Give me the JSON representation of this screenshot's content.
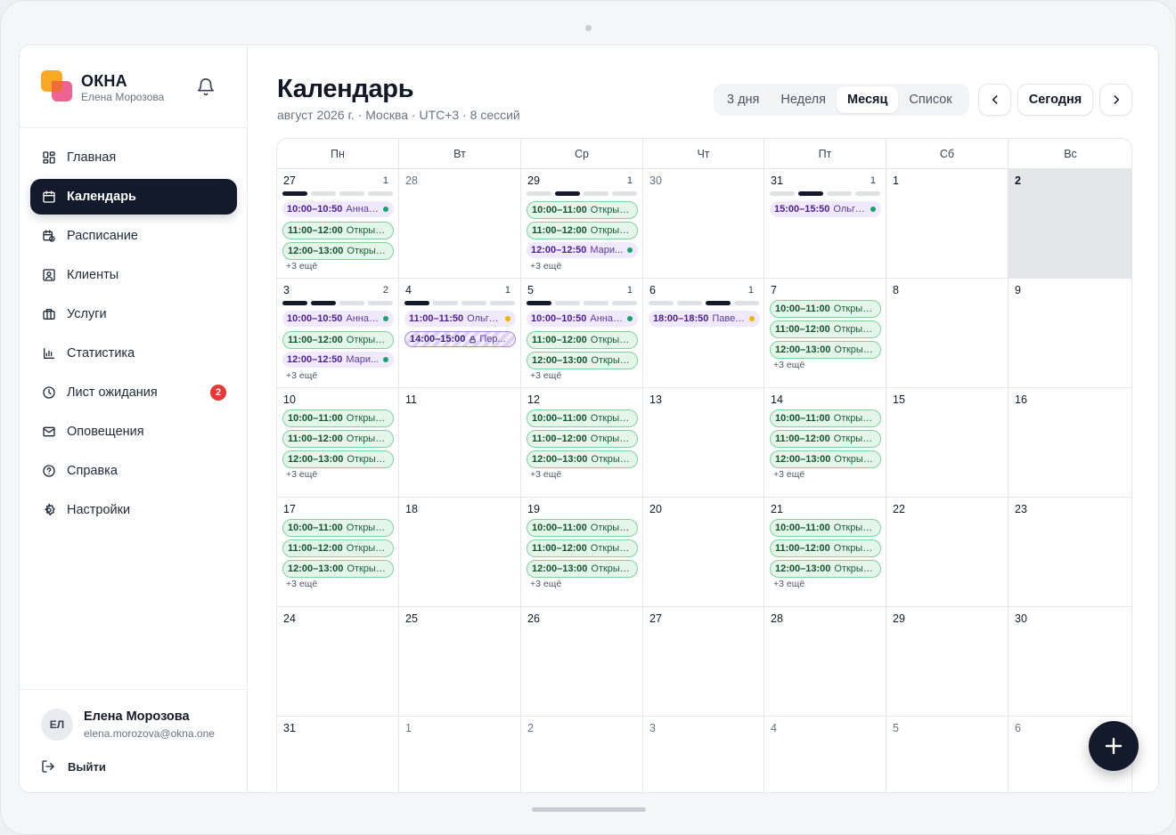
{
  "brand": {
    "name": "ОКНА",
    "user": "Елена Морозова"
  },
  "nav": [
    {
      "label": "Главная",
      "icon": "dashboard-icon",
      "active": false
    },
    {
      "label": "Календарь",
      "icon": "calendar-icon",
      "active": true
    },
    {
      "label": "Расписание",
      "icon": "schedule-icon",
      "active": false
    },
    {
      "label": "Клиенты",
      "icon": "clients-icon",
      "active": false
    },
    {
      "label": "Услуги",
      "icon": "services-icon",
      "active": false
    },
    {
      "label": "Статистика",
      "icon": "statistics-icon",
      "active": false
    },
    {
      "label": "Лист ожидания",
      "icon": "waitlist-icon",
      "active": false,
      "badge": "2"
    },
    {
      "label": "Оповещения",
      "icon": "mail-icon",
      "active": false
    },
    {
      "label": "Справка",
      "icon": "help-icon",
      "active": false
    },
    {
      "label": "Настройки",
      "icon": "settings-icon",
      "active": false
    }
  ],
  "user": {
    "initials": "ЕЛ",
    "name": "Елена Морозова",
    "email": "elena.morozova@okna.one",
    "logout": "Выйти"
  },
  "header": {
    "title": "Календарь",
    "subtitle": "август 2026 г. · Москва · UTC+3 · 8 сессий"
  },
  "views": [
    {
      "label": "3 дня",
      "active": false
    },
    {
      "label": "Неделя",
      "active": false
    },
    {
      "label": "Месяц",
      "active": true
    },
    {
      "label": "Список",
      "active": false
    }
  ],
  "today_label": "Сегодня",
  "colors": {
    "green_dot": "#1aa36b",
    "amber_dot": "#f5b301",
    "accent_dark": "#121a2b",
    "badge_red": "#e53935"
  },
  "weekdays": [
    "Пн",
    "Вт",
    "Ср",
    "Чт",
    "Пт",
    "Сб",
    "Вс"
  ],
  "weeks": [
    [
      {
        "day": "27",
        "count": "1",
        "bars": [
          1,
          0,
          0,
          0
        ],
        "events": [
          {
            "time": "10:00–10:50",
            "name": "Анна ...",
            "style": "purple",
            "dot": "green"
          },
          {
            "time": "11:00–12:00",
            "name": "Открыт ...",
            "style": "green"
          },
          {
            "time": "12:00–13:00",
            "name": "Открыт ...",
            "style": "green"
          }
        ],
        "more": "+3 ещё"
      },
      {
        "day": "28",
        "muted": true,
        "events": []
      },
      {
        "day": "29",
        "count": "1",
        "bars": [
          0,
          1,
          0,
          0
        ],
        "events": [
          {
            "time": "10:00–11:00",
            "name": "Открыт ...",
            "style": "green"
          },
          {
            "time": "11:00–12:00",
            "name": "Открыт ...",
            "style": "green"
          },
          {
            "time": "12:00–12:50",
            "name": "Мари...",
            "style": "purple",
            "dot": "green"
          }
        ],
        "more": "+3 ещё"
      },
      {
        "day": "30",
        "muted": true,
        "events": []
      },
      {
        "day": "31",
        "count": "1",
        "bars": [
          0,
          1,
          0,
          0
        ],
        "events": [
          {
            "time": "15:00–15:50",
            "name": "Ольга...",
            "style": "purple",
            "dot": "green"
          }
        ]
      },
      {
        "day": "1",
        "events": []
      },
      {
        "day": "2",
        "today": true,
        "events": []
      }
    ],
    [
      {
        "day": "3",
        "count": "2",
        "bars": [
          1,
          1,
          0,
          0
        ],
        "events": [
          {
            "time": "10:00–10:50",
            "name": "Анна ...",
            "style": "purple",
            "dot": "green"
          },
          {
            "time": "11:00–12:00",
            "name": "Открыт ...",
            "style": "green"
          },
          {
            "time": "12:00–12:50",
            "name": "Мари...",
            "style": "purple",
            "dot": "green"
          }
        ],
        "more": "+3 ещё"
      },
      {
        "day": "4",
        "count": "1",
        "bars": [
          1,
          0,
          0,
          0
        ],
        "events": [
          {
            "time": "11:00–11:50",
            "name": "Ольга...",
            "style": "purple",
            "dot": "amber"
          },
          {
            "time": "14:00–15:00",
            "name": "Пер...",
            "style": "hatch",
            "lock": true
          }
        ]
      },
      {
        "day": "5",
        "count": "1",
        "bars": [
          1,
          0,
          0,
          0
        ],
        "events": [
          {
            "time": "10:00–10:50",
            "name": "Анна ...",
            "style": "purple",
            "dot": "green"
          },
          {
            "time": "11:00–12:00",
            "name": "Открыт ...",
            "style": "green"
          },
          {
            "time": "12:00–13:00",
            "name": "Открыт ...",
            "style": "green"
          }
        ],
        "more": "+3 ещё"
      },
      {
        "day": "6",
        "count": "1",
        "bars": [
          0,
          0,
          1,
          0
        ],
        "events": [
          {
            "time": "18:00–18:50",
            "name": "Павел...",
            "style": "purple",
            "dot": "amber"
          }
        ]
      },
      {
        "day": "7",
        "events": [
          {
            "time": "10:00–11:00",
            "name": "Открыт ...",
            "style": "green"
          },
          {
            "time": "11:00–12:00",
            "name": "Открыт ...",
            "style": "green"
          },
          {
            "time": "12:00–13:00",
            "name": "Открыт ...",
            "style": "green"
          }
        ],
        "more": "+3 ещё"
      },
      {
        "day": "8",
        "events": []
      },
      {
        "day": "9",
        "events": []
      }
    ],
    [
      {
        "day": "10",
        "events": [
          {
            "time": "10:00–11:00",
            "name": "Открыт ...",
            "style": "green"
          },
          {
            "time": "11:00–12:00",
            "name": "Открыт ...",
            "style": "green"
          },
          {
            "time": "12:00–13:00",
            "name": "Открыт ...",
            "style": "green"
          }
        ],
        "more": "+3 ещё"
      },
      {
        "day": "11",
        "events": []
      },
      {
        "day": "12",
        "events": [
          {
            "time": "10:00–11:00",
            "name": "Открыт ...",
            "style": "green"
          },
          {
            "time": "11:00–12:00",
            "name": "Открыт ...",
            "style": "green"
          },
          {
            "time": "12:00–13:00",
            "name": "Открыт ...",
            "style": "green"
          }
        ],
        "more": "+3 ещё"
      },
      {
        "day": "13",
        "events": []
      },
      {
        "day": "14",
        "events": [
          {
            "time": "10:00–11:00",
            "name": "Открыт ...",
            "style": "green"
          },
          {
            "time": "11:00–12:00",
            "name": "Открыт ...",
            "style": "green"
          },
          {
            "time": "12:00–13:00",
            "name": "Открыт ...",
            "style": "green"
          }
        ],
        "more": "+3 ещё"
      },
      {
        "day": "15",
        "events": []
      },
      {
        "day": "16",
        "events": []
      }
    ],
    [
      {
        "day": "17",
        "events": [
          {
            "time": "10:00–11:00",
            "name": "Открыт ...",
            "style": "green"
          },
          {
            "time": "11:00–12:00",
            "name": "Открыт ...",
            "style": "green"
          },
          {
            "time": "12:00–13:00",
            "name": "Открыт ...",
            "style": "green"
          }
        ],
        "more": "+3 ещё"
      },
      {
        "day": "18",
        "events": []
      },
      {
        "day": "19",
        "events": [
          {
            "time": "10:00–11:00",
            "name": "Открыт ...",
            "style": "green"
          },
          {
            "time": "11:00–12:00",
            "name": "Открыт ...",
            "style": "green"
          },
          {
            "time": "12:00–13:00",
            "name": "Открыт ...",
            "style": "green"
          }
        ],
        "more": "+3 ещё"
      },
      {
        "day": "20",
        "events": []
      },
      {
        "day": "21",
        "events": [
          {
            "time": "10:00–11:00",
            "name": "Открыт ...",
            "style": "green"
          },
          {
            "time": "11:00–12:00",
            "name": "Открыт ...",
            "style": "green"
          },
          {
            "time": "12:00–13:00",
            "name": "Открыт ...",
            "style": "green"
          }
        ],
        "more": "+3 ещё"
      },
      {
        "day": "22",
        "events": []
      },
      {
        "day": "23",
        "events": []
      }
    ],
    [
      {
        "day": "24",
        "events": []
      },
      {
        "day": "25",
        "events": []
      },
      {
        "day": "26",
        "events": []
      },
      {
        "day": "27",
        "events": []
      },
      {
        "day": "28",
        "events": []
      },
      {
        "day": "29",
        "events": []
      },
      {
        "day": "30",
        "events": []
      }
    ],
    [
      {
        "day": "31",
        "events": []
      },
      {
        "day": "1",
        "muted": true,
        "events": []
      },
      {
        "day": "2",
        "muted": true,
        "events": []
      },
      {
        "day": "3",
        "muted": true,
        "events": []
      },
      {
        "day": "4",
        "muted": true,
        "events": []
      },
      {
        "day": "5",
        "muted": true,
        "events": []
      },
      {
        "day": "6",
        "muted": true,
        "events": []
      }
    ]
  ]
}
